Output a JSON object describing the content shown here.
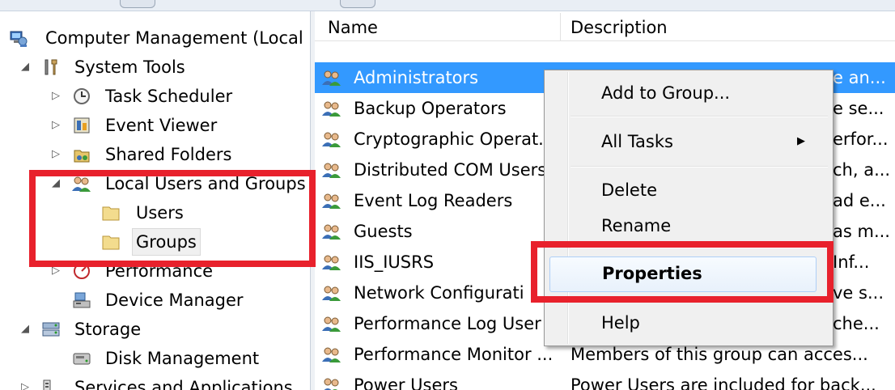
{
  "tree": {
    "root": "Computer Management (Local",
    "system_tools": "System Tools",
    "task_scheduler": "Task Scheduler",
    "event_viewer": "Event Viewer",
    "shared_folders": "Shared Folders",
    "local_users_groups": "Local Users and Groups",
    "users": "Users",
    "groups": "Groups",
    "performance": "Performance",
    "device_manager": "Device Manager",
    "storage": "Storage",
    "disk_management": "Disk Management",
    "services_apps": "Services and Applications"
  },
  "list": {
    "col_name": "Name",
    "col_description": "Description",
    "rows": [
      {
        "name": "Administrators",
        "desc": "e an..."
      },
      {
        "name": "Backup Operators",
        "desc": "e se..."
      },
      {
        "name": "Cryptographic Operat...",
        "desc": "erfor..."
      },
      {
        "name": "Distributed COM Users",
        "desc": "ch, a..."
      },
      {
        "name": "Event Log Readers",
        "desc": "ad e..."
      },
      {
        "name": "Guests",
        "desc": "as m..."
      },
      {
        "name": "IIS_IUSRS",
        "desc": "Inf..."
      },
      {
        "name": "Network Configurati",
        "desc": "ve s..."
      },
      {
        "name": "Performance Log User",
        "desc": "che..."
      },
      {
        "name": "Performance Monitor ...",
        "desc": "Members of this group can acces..."
      },
      {
        "name": "Power Users",
        "desc": "Power Users are included for back..."
      }
    ]
  },
  "menu": {
    "add_to_group": "Add to Group...",
    "all_tasks": "All Tasks",
    "delete": "Delete",
    "rename": "Rename",
    "properties": "Properties",
    "help": "Help"
  },
  "colors": {
    "selection": "#3399ff",
    "annotation_red": "#e8212c",
    "menu_bg": "#f0f0f0"
  }
}
